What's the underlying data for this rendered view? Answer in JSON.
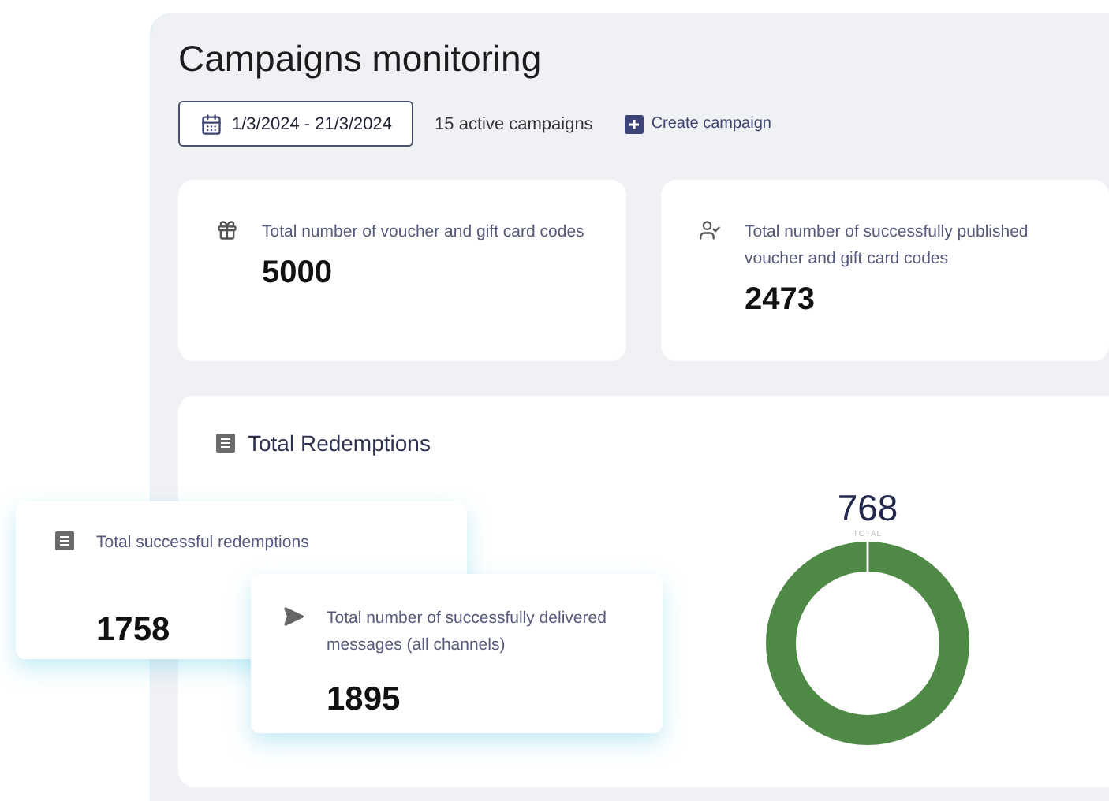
{
  "header": {
    "title": "Campaigns monitoring",
    "date_range": "1/3/2024 - 21/3/2024",
    "active_campaigns": "15 active campaigns",
    "create_button": "Create campaign"
  },
  "stats": [
    {
      "kind": "gift",
      "label": "Total number of voucher and gift card codes",
      "value": "5000"
    },
    {
      "kind": "user",
      "label": "Total number of successfully published voucher and gift card codes",
      "value": "2473"
    }
  ],
  "redemptions": {
    "title": "Total Redemptions",
    "total": "768",
    "total_label": "TOTAL"
  },
  "floating_cards": [
    {
      "kind": "list",
      "label": "Total successful redemptions",
      "value": "1758"
    },
    {
      "kind": "send",
      "label": "Total number of successfully delivered messages (all channels)",
      "value": "1895"
    }
  ]
}
